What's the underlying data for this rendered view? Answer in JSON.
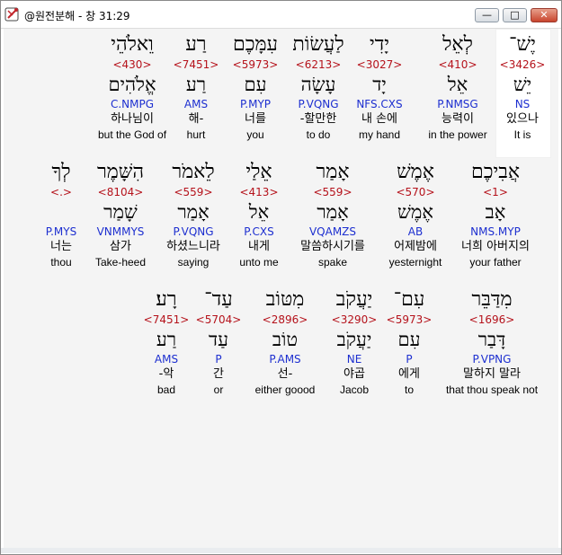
{
  "window": {
    "title": "@원전분해 - 창 31:29",
    "buttons": {
      "minimize": "—",
      "maximize": "□",
      "close": "✕"
    }
  },
  "rows": [
    {
      "words": [
        {
          "heb": "וֵאלֹהֵי",
          "strong": "<430>",
          "lemma": "אֱלֹהִים",
          "morph": "C.NMPG",
          "kor": "하나님이",
          "eng": "but the God of"
        },
        {
          "heb": "רַע",
          "strong": "<7451>",
          "lemma": "רַע",
          "morph": "AMS",
          "kor": "해-",
          "eng": "hurt"
        },
        {
          "heb": "עִמָּכֶם",
          "strong": "<5973>",
          "lemma": "עִם",
          "morph": "P.MYP",
          "kor": "너를",
          "eng": "you"
        },
        {
          "heb": "לַעֲשׂוֹת",
          "strong": "<6213>",
          "lemma": "עָשָׂה",
          "morph": "P.VQNG",
          "kor": "-할만한",
          "eng": "to do"
        },
        {
          "heb": "יָדִי",
          "strong": "<3027>",
          "lemma": "יָד",
          "morph": "NFS.CXS",
          "kor": "내 손에",
          "eng": "my hand"
        },
        {
          "heb": "לְאֵל",
          "strong": "<410>",
          "lemma": "אֵל",
          "morph": "P.NMSG",
          "kor": "능력이",
          "eng": "in the power"
        },
        {
          "heb": "יֶשׁ־",
          "strong": "<3426>",
          "lemma": "יֵשׁ",
          "morph": "NS",
          "kor": "있으나",
          "eng": "It is"
        }
      ]
    },
    {
      "words": [
        {
          "heb": "לְךָ",
          "strong": "<.>",
          "lemma": "",
          "morph": "P.MYS",
          "kor": "너는",
          "eng": "thou"
        },
        {
          "heb": "הִשָּׁמֶר",
          "strong": "<8104>",
          "lemma": "שָׁמַר",
          "morph": "VNMMYS",
          "kor": "삼가",
          "eng": "Take-heed"
        },
        {
          "heb": "לֵאמֹר",
          "strong": "<559>",
          "lemma": "אָמַר",
          "morph": "P.VQNG",
          "kor": "하셨느니라",
          "eng": "saying"
        },
        {
          "heb": "אֵלַי",
          "strong": "<413>",
          "lemma": "אֵל",
          "morph": "P.CXS",
          "kor": "내게",
          "eng": "unto me"
        },
        {
          "heb": "אָמַר",
          "strong": "<559>",
          "lemma": "אָמַר",
          "morph": "VQAMZS",
          "kor": "말씀하시기를",
          "eng": "spake"
        },
        {
          "heb": "אֶמֶשׁ",
          "strong": "<570>",
          "lemma": "אֶמֶשׁ",
          "morph": "AB",
          "kor": "어제밤에",
          "eng": "yesternight"
        },
        {
          "heb": "אֲבִיכֶם",
          "strong": "<1>",
          "lemma": "אָב",
          "morph": "NMS.MYP",
          "kor": "너희 아버지의",
          "eng": "your father"
        }
      ]
    },
    {
      "words": [
        {
          "heb": "רָע׃",
          "strong": "<7451>",
          "lemma": "רַע",
          "morph": "AMS",
          "kor": "-악",
          "eng": "bad"
        },
        {
          "heb": "עַד־",
          "strong": "<5704>",
          "lemma": "עַד",
          "morph": "P",
          "kor": "간",
          "eng": "or"
        },
        {
          "heb": "מִטּוֹב",
          "strong": "<2896>",
          "lemma": "טוֹב",
          "morph": "P.AMS",
          "kor": "선-",
          "eng": "either goood"
        },
        {
          "heb": "יַעֲקֹב",
          "strong": "<3290>",
          "lemma": "יַעֲקֹב",
          "morph": "NE",
          "kor": "야곱",
          "eng": "Jacob"
        },
        {
          "heb": "עִם־",
          "strong": "<5973>",
          "lemma": "עִם",
          "morph": "P",
          "kor": "에게",
          "eng": "to"
        },
        {
          "heb": "מִדַּבֵּר",
          "strong": "<1696>",
          "lemma": "דָּבַר",
          "morph": "P.VPNG",
          "kor": "말하지 말라",
          "eng": "that thou speak not"
        }
      ]
    }
  ]
}
